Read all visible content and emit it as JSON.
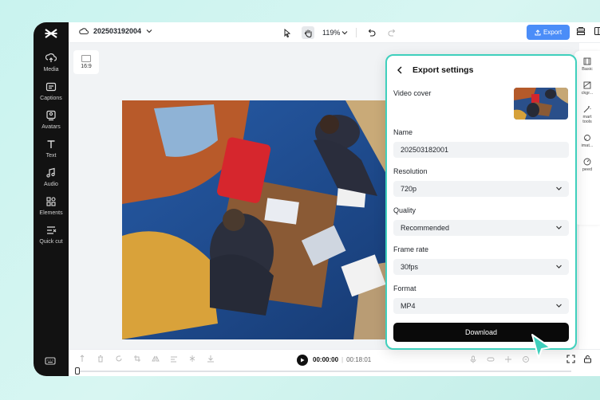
{
  "sidebar": {
    "items": [
      {
        "label": "Media",
        "icon": "media-icon"
      },
      {
        "label": "Captions",
        "icon": "captions-icon"
      },
      {
        "label": "Avatars",
        "icon": "avatars-icon"
      },
      {
        "label": "Text",
        "icon": "text-icon"
      },
      {
        "label": "Audio",
        "icon": "audio-icon"
      },
      {
        "label": "Elements",
        "icon": "elements-icon"
      },
      {
        "label": "Quick cut",
        "icon": "quick-cut-icon"
      }
    ]
  },
  "topbar": {
    "project_name": "202503192004",
    "zoom": "119%",
    "export_label": "Export"
  },
  "canvas": {
    "ratio_label": "16:9"
  },
  "right_rail": {
    "items": [
      "Basic",
      "ckgr...",
      "mart tools",
      "imat...",
      "peed"
    ]
  },
  "timeline": {
    "current_time": "00:00:00",
    "total_time": "00:18:01"
  },
  "export_panel": {
    "title": "Export settings",
    "video_cover_label": "Video cover",
    "name_label": "Name",
    "name_value": "202503182001",
    "resolution_label": "Resolution",
    "resolution_value": "720p",
    "quality_label": "Quality",
    "quality_value": "Recommended",
    "frame_rate_label": "Frame rate",
    "frame_rate_value": "30fps",
    "format_label": "Format",
    "format_value": "MP4",
    "download_label": "Download"
  },
  "colors": {
    "accent": "#4b8df8",
    "panel_border": "#3fd0bd",
    "sidebar_bg": "#121212",
    "download_bg": "#0a0a0a"
  }
}
